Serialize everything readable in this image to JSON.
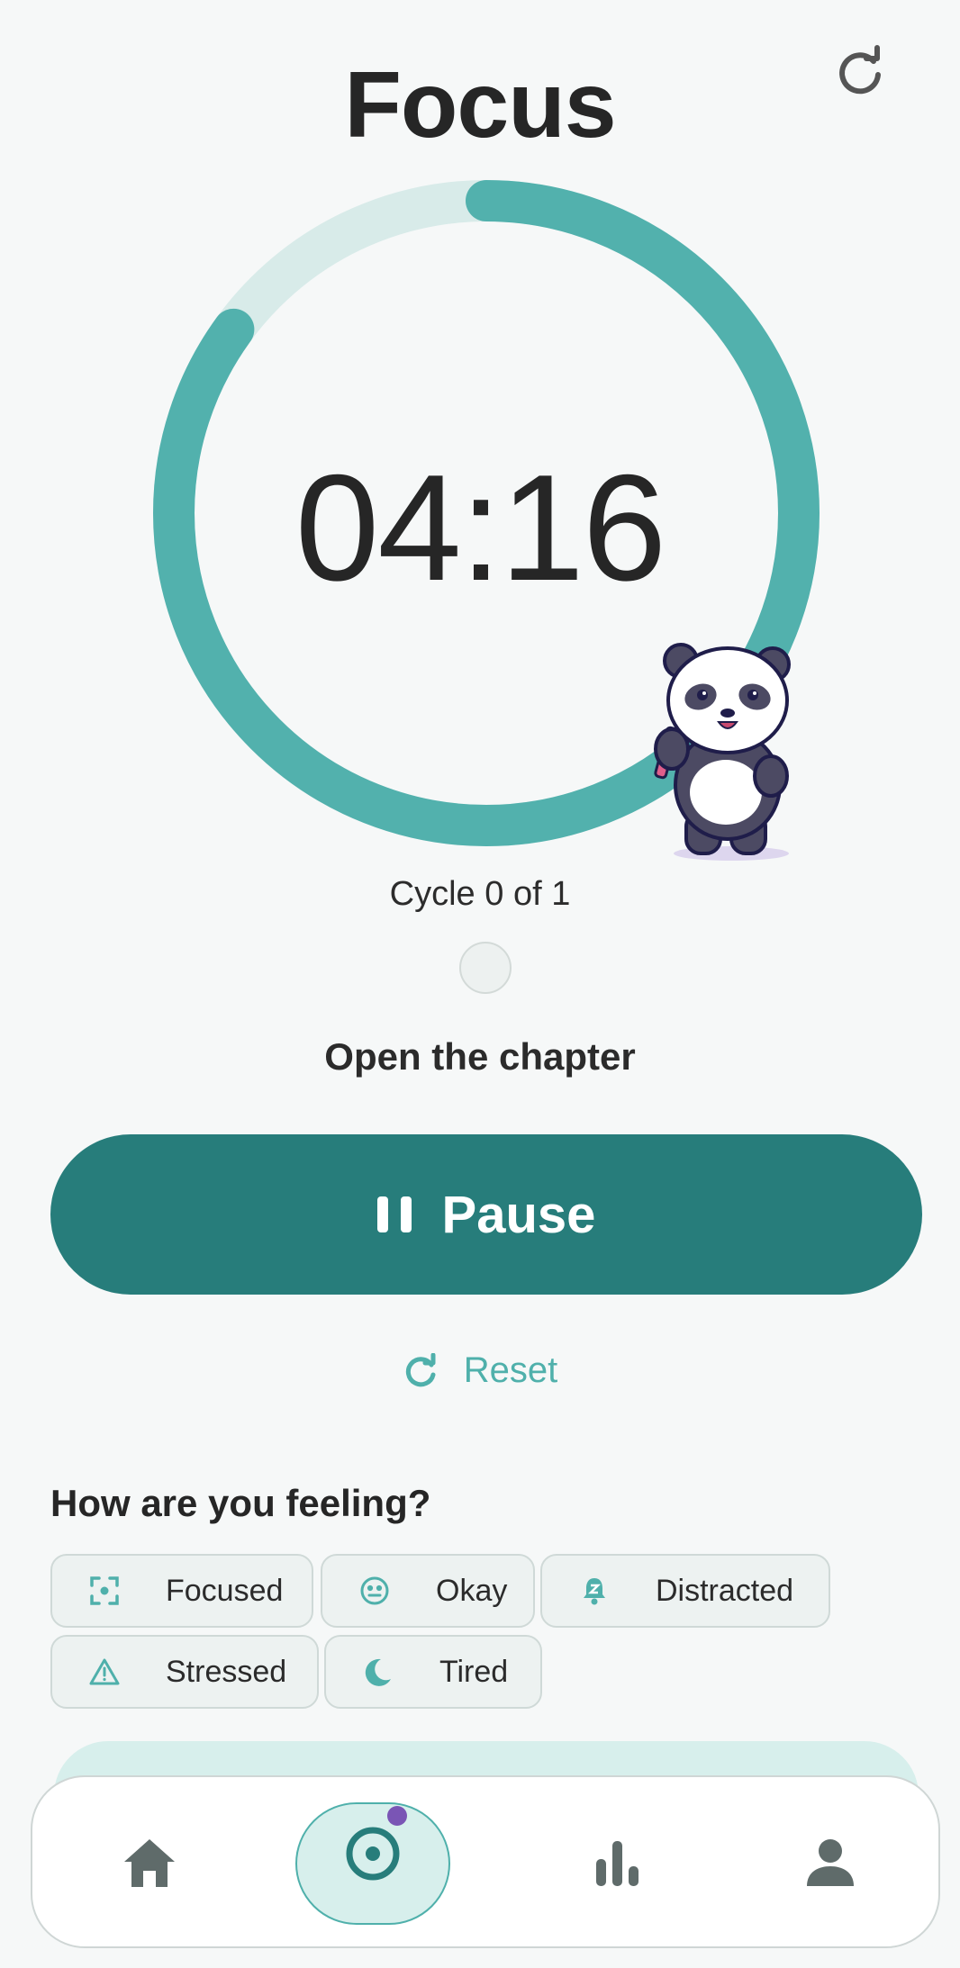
{
  "header": {
    "title": "Focus",
    "refresh_icon": "refresh-icon"
  },
  "timer": {
    "time": "04:16",
    "progress": 0.85,
    "track_color": "#d8ebe9",
    "progress_color": "#52b1ad",
    "cycle_text": "Cycle 0 of 1"
  },
  "task": {
    "label": "Open the chapter"
  },
  "controls": {
    "pause_label": "Pause",
    "reset_label": "Reset",
    "accent": "#277d7b",
    "link_color": "#4fb0ab"
  },
  "feelings": {
    "title": "How are you feeling?",
    "options": [
      {
        "label": "Focused",
        "icon": "focus-frame-icon"
      },
      {
        "label": "Okay",
        "icon": "neutral-face-icon"
      },
      {
        "label": "Distracted",
        "icon": "bell-z-icon"
      },
      {
        "label": "Stressed",
        "icon": "warning-icon"
      },
      {
        "label": "Tired",
        "icon": "moon-icon"
      }
    ]
  },
  "nav": {
    "items": [
      {
        "name": "home",
        "icon": "home-icon"
      },
      {
        "name": "focus",
        "icon": "focus-target-icon",
        "active": true
      },
      {
        "name": "stats",
        "icon": "bar-chart-icon"
      },
      {
        "name": "profile",
        "icon": "person-icon"
      }
    ]
  }
}
